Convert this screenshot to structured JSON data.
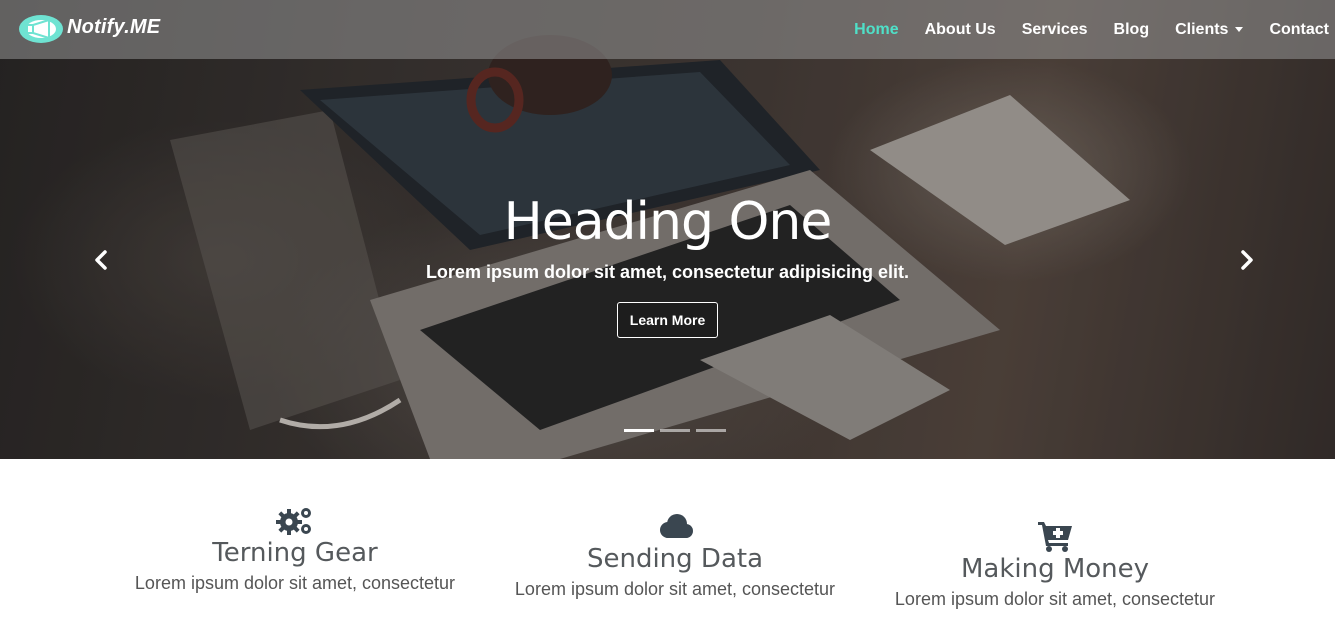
{
  "brand": {
    "name": "Notify.ME",
    "accent": "#4fe0c8"
  },
  "nav": {
    "items": [
      {
        "label": "Home",
        "active": true
      },
      {
        "label": "About Us",
        "active": false
      },
      {
        "label": "Services",
        "active": false
      },
      {
        "label": "Blog",
        "active": false
      },
      {
        "label": "Clients",
        "active": false,
        "dropdown": true
      },
      {
        "label": "Contact",
        "active": false
      }
    ]
  },
  "carousel": {
    "heading": "Heading One",
    "subtitle": "Lorem ipsum dolor sit amet, consectetur adipisicing elit.",
    "button_label": "Learn More",
    "prev_icon": "chevron-left-icon",
    "next_icon": "chevron-right-icon",
    "slide_count": 3,
    "active_slide": 1
  },
  "features": [
    {
      "icon": "gears-icon",
      "title": "Terning Gear",
      "text": "Lorem ipsum dolor sit amet, consectetur"
    },
    {
      "icon": "cloud-icon",
      "title": "Sending Data",
      "text": "Lorem ipsum dolor sit amet, consectetur"
    },
    {
      "icon": "cart-plus-icon",
      "title": "Making Money",
      "text": "Lorem ipsum dolor sit amet, consectetur"
    }
  ],
  "colors": {
    "feature_icon": "#3a4650",
    "heading_text": "#55595c"
  }
}
